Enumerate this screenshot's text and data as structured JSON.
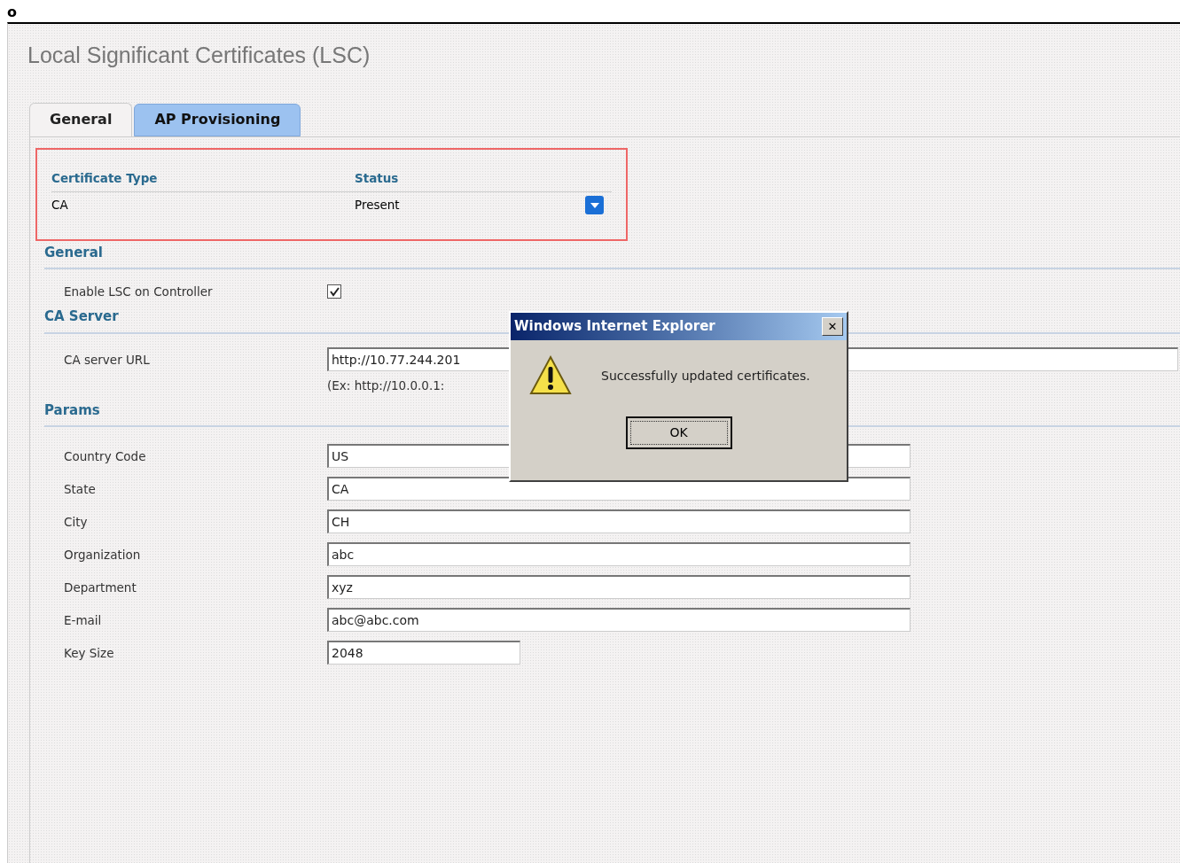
{
  "corner_mark": "o",
  "page": {
    "title": "Local Significant Certificates (LSC)"
  },
  "tabs": [
    {
      "label": "General",
      "selected": true
    },
    {
      "label": "AP Provisioning",
      "selected": false
    }
  ],
  "certificates": {
    "columns": [
      "Certificate Type",
      "Status"
    ],
    "rows": [
      {
        "type": "CA",
        "status": "Present"
      }
    ]
  },
  "sections": [
    {
      "heading": "General",
      "fields": [
        {
          "kind": "checkbox",
          "label": "Enable LSC on Controller",
          "checked": true
        }
      ]
    },
    {
      "heading": "CA Server",
      "fields": [
        {
          "kind": "url",
          "label": "CA server URL",
          "value": "http://10.77.244.201",
          "hint": "(Ex: http://10.0.0.1:"
        }
      ]
    },
    {
      "heading": "Params",
      "fields": [
        {
          "kind": "text",
          "label": "Country Code",
          "value": "US"
        },
        {
          "kind": "text",
          "label": "State",
          "value": "CA"
        },
        {
          "kind": "text",
          "label": "City",
          "value": "CH"
        },
        {
          "kind": "text",
          "label": "Organization",
          "value": "abc"
        },
        {
          "kind": "text",
          "label": "Department",
          "value": "xyz"
        },
        {
          "kind": "text",
          "label": "E-mail",
          "value": "abc@abc.com"
        },
        {
          "kind": "short",
          "label": "Key Size",
          "value": "2048"
        }
      ]
    }
  ],
  "dialog": {
    "title": "Windows Internet Explorer",
    "close": "✕",
    "message": "Successfully updated certificates.",
    "button": "OK"
  }
}
